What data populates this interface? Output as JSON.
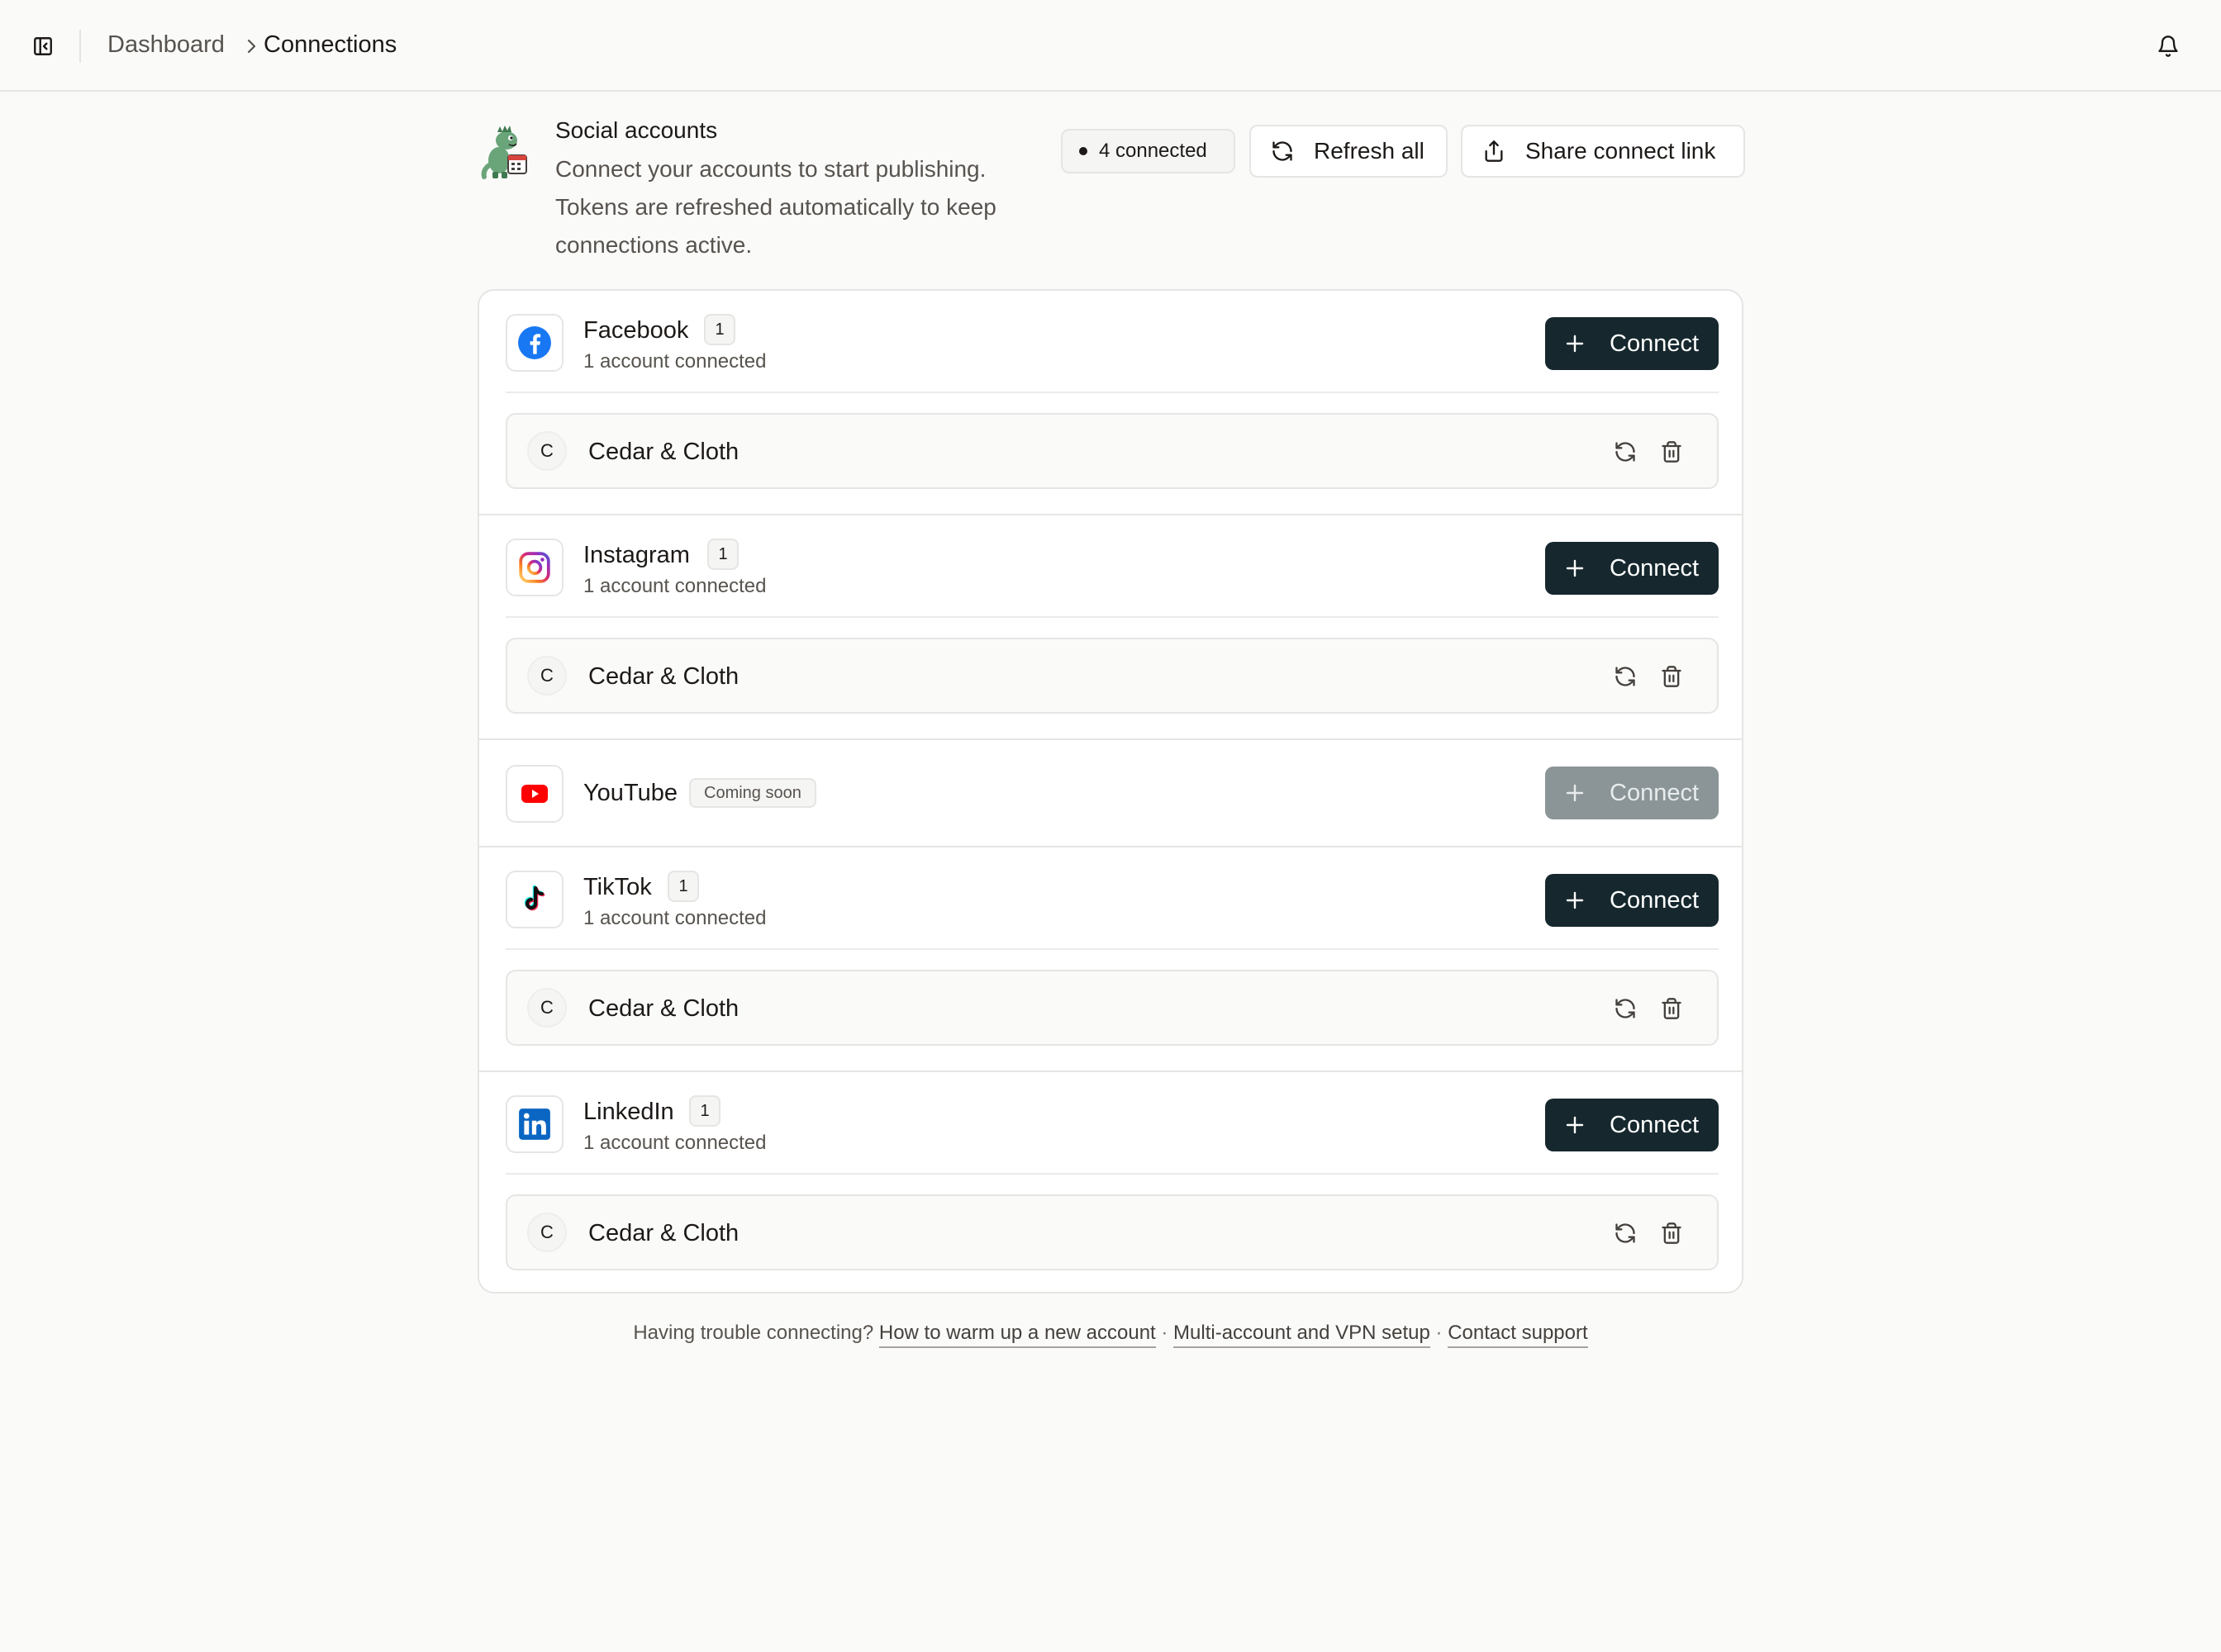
{
  "breadcrumb": {
    "parent": "Dashboard",
    "current": "Connections"
  },
  "header": {
    "title": "Social accounts",
    "description": "Connect your accounts to start publishing. Tokens are refreshed automatically to keep connections active.",
    "connected_label": "4 connected",
    "refresh_all_label": "Refresh all",
    "share_link_label": "Share connect link"
  },
  "platforms": [
    {
      "name": "Facebook",
      "icon": "facebook-icon",
      "count": "1",
      "subtitle": "1 account connected",
      "connect_label": "Connect",
      "accounts": [
        {
          "initial": "C",
          "name": "Cedar & Cloth"
        }
      ]
    },
    {
      "name": "Instagram",
      "icon": "instagram-icon",
      "count": "1",
      "subtitle": "1 account connected",
      "connect_label": "Connect",
      "accounts": [
        {
          "initial": "C",
          "name": "Cedar & Cloth"
        }
      ]
    },
    {
      "name": "YouTube",
      "icon": "youtube-icon",
      "badge": "Coming soon",
      "connect_label": "Connect",
      "disabled": true
    },
    {
      "name": "TikTok",
      "icon": "tiktok-icon",
      "count": "1",
      "subtitle": "1 account connected",
      "connect_label": "Connect",
      "accounts": [
        {
          "initial": "C",
          "name": "Cedar & Cloth"
        }
      ]
    },
    {
      "name": "LinkedIn",
      "icon": "linkedin-icon",
      "count": "1",
      "subtitle": "1 account connected",
      "connect_label": "Connect",
      "accounts": [
        {
          "initial": "C",
          "name": "Cedar & Cloth"
        }
      ]
    }
  ],
  "footer": {
    "prefix": "Having trouble connecting?",
    "links": [
      "How to warm up a new account",
      "Multi-account and VPN setup",
      "Contact support"
    ],
    "separator": "·"
  },
  "colors": {
    "primary_button": "#16282e",
    "disabled_button": "#8b9597",
    "facebook": "#1877f2",
    "youtube": "#ff0000",
    "linkedin": "#0a66c2"
  }
}
